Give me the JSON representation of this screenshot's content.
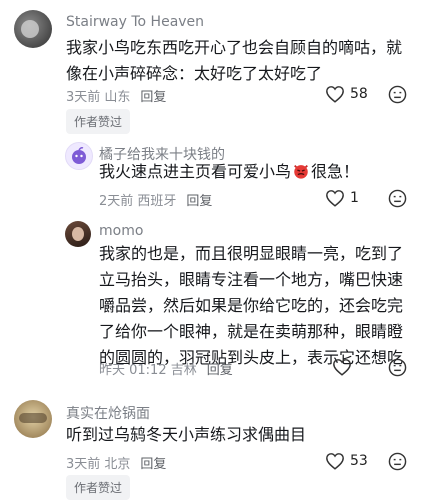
{
  "comments": [
    {
      "username": "Stairway To Heaven",
      "text": "我家小鸟吃东西吃开心了也会自顾自的嘀咕，就像在小声碎碎念：太好吃了太好吃了",
      "meta": "3天前 山东",
      "reply_label": "回复",
      "likes": "58",
      "badge": "作者赞过"
    },
    {
      "username": "橘子给我来十块钱的",
      "text_before_emoji": "我火速点进主页看可爱小鸟",
      "text_after_emoji": "很急！",
      "emoji_icon": "angry-devil-emoji-icon",
      "meta": "2天前 西班牙",
      "reply_label": "回复",
      "likes": "1"
    },
    {
      "username": "momo",
      "text": "我家的也是，而且很明显眼睛一亮，吃到了立马抬头，眼睛专注看一个地方，嘴巴快速嚼品尝，然后如果是你给它吃的，还会吃完了给你一个眼神，就是在卖萌那种，眼睛瞪的圆圆的，羽冠贴到头皮上，表示它还想吃",
      "meta": "昨天 01:12 吉林",
      "reply_label": "回复",
      "likes": ""
    },
    {
      "username": "真实在炝锅面",
      "text": "听到过乌鸫冬天小声练习求偶曲目",
      "meta": "3天前 北京",
      "reply_label": "回复",
      "likes": "53",
      "badge": "作者赞过"
    }
  ],
  "colors": {
    "text": "#16181c",
    "meta": "#8a8e95",
    "username": "#7b7f86",
    "badge_bg": "#f1f2f4"
  }
}
